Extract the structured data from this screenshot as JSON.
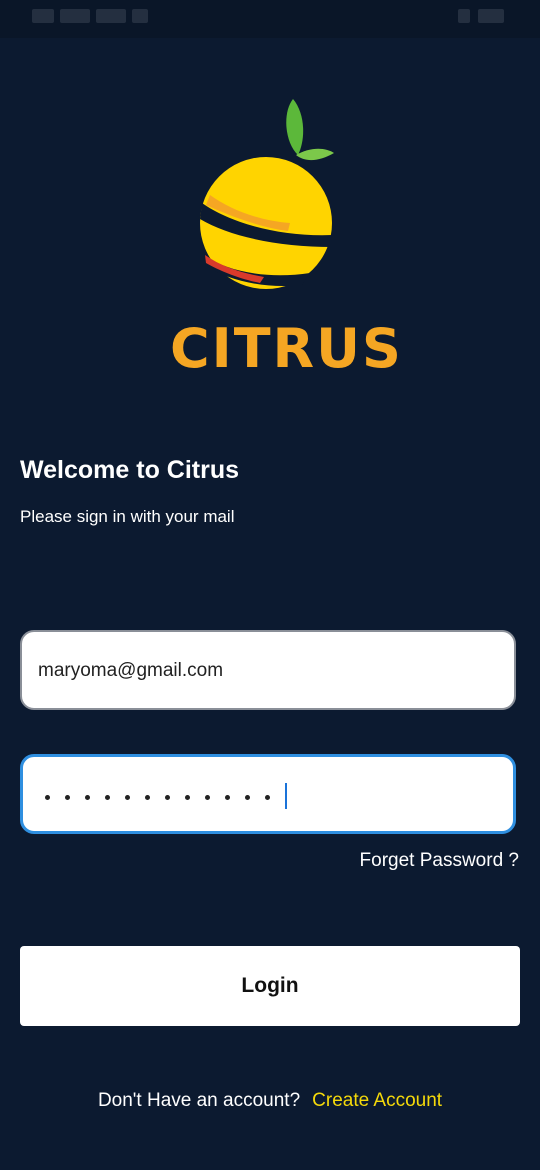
{
  "brand": {
    "name": "CITRUS",
    "accent": "#f5a623",
    "fruit_yellow": "#ffd400",
    "leaf_green": "#5cb83a",
    "stripe_red": "#d93a2b"
  },
  "welcome": {
    "title": "Welcome to Citrus",
    "subtitle": "Please sign in with your mail"
  },
  "form": {
    "email_value": "maryoma@gmail.com",
    "password_mask_count": 12,
    "forgot_label": "Forget Password ?",
    "login_label": "Login"
  },
  "footer": {
    "prompt": "Don't Have an account?",
    "create_label": "Create Account",
    "link_color": "#f5d90a"
  },
  "colors": {
    "background": "#0c1a30",
    "focus_border": "#2f8fe0"
  }
}
